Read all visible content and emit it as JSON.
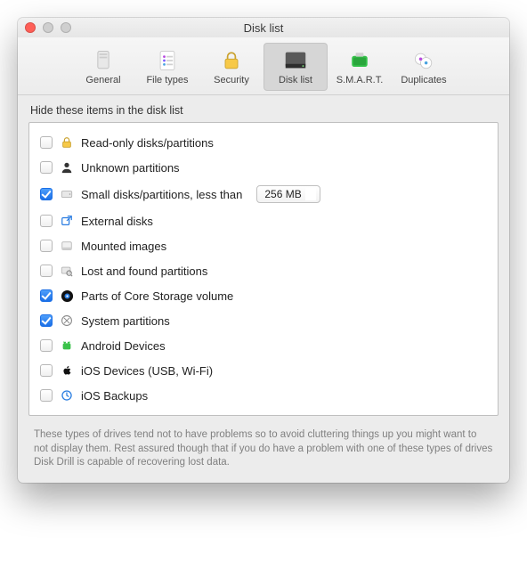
{
  "window": {
    "title": "Disk list"
  },
  "toolbar": {
    "items": [
      {
        "id": "general",
        "label": "General"
      },
      {
        "id": "file-types",
        "label": "File types"
      },
      {
        "id": "security",
        "label": "Security"
      },
      {
        "id": "disk-list",
        "label": "Disk list"
      },
      {
        "id": "smart",
        "label": "S.M.A.R.T."
      },
      {
        "id": "duplicates",
        "label": "Duplicates"
      }
    ],
    "selected_id": "disk-list"
  },
  "section_label": "Hide these items in the disk list",
  "hide_items": [
    {
      "id": "readonly",
      "checked": false,
      "icon": "lock-icon",
      "label": "Read-only disks/partitions"
    },
    {
      "id": "unknown",
      "checked": false,
      "icon": "person-icon",
      "label": "Unknown partitions"
    },
    {
      "id": "small",
      "checked": true,
      "icon": "disk-small-icon",
      "label": "Small disks/partitions, less than",
      "select_value": "256 MB"
    },
    {
      "id": "external",
      "checked": false,
      "icon": "external-icon",
      "label": "External disks"
    },
    {
      "id": "mounted",
      "checked": false,
      "icon": "image-disk-icon",
      "label": "Mounted images"
    },
    {
      "id": "lostfound",
      "checked": false,
      "icon": "search-disk-icon",
      "label": "Lost and found partitions"
    },
    {
      "id": "corestorage",
      "checked": true,
      "icon": "corestorage-icon",
      "label": "Parts of Core Storage volume"
    },
    {
      "id": "system",
      "checked": true,
      "icon": "system-icon",
      "label": "System partitions"
    },
    {
      "id": "android",
      "checked": false,
      "icon": "android-icon",
      "label": "Android Devices"
    },
    {
      "id": "ios",
      "checked": false,
      "icon": "apple-icon",
      "label": "iOS Devices (USB, Wi-Fi)"
    },
    {
      "id": "iosbackup",
      "checked": false,
      "icon": "clock-icon",
      "label": "iOS Backups"
    }
  ],
  "footer": "These types of drives tend not to have problems so to avoid cluttering things up you might want to not display them. Rest assured though that if you do have a problem with one of these types of drives Disk Drill is capable of recovering lost data."
}
